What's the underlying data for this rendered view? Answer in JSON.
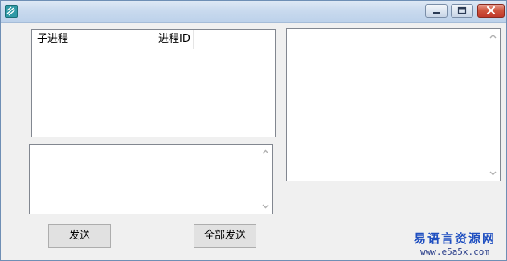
{
  "window": {
    "title": "",
    "icon": "app-icon"
  },
  "titlebar": {
    "controls": [
      "minimize-icon",
      "maximize-icon",
      "close-icon"
    ]
  },
  "process_list": {
    "columns": [
      "子进程",
      "进程ID"
    ],
    "rows": []
  },
  "message_input": {
    "value": ""
  },
  "output_box": {
    "value": ""
  },
  "buttons": {
    "send_label": "发送",
    "send_all_label": "全部发送"
  },
  "watermark": {
    "title": "易语言资源网",
    "url": "www.e5a5x.com"
  }
}
